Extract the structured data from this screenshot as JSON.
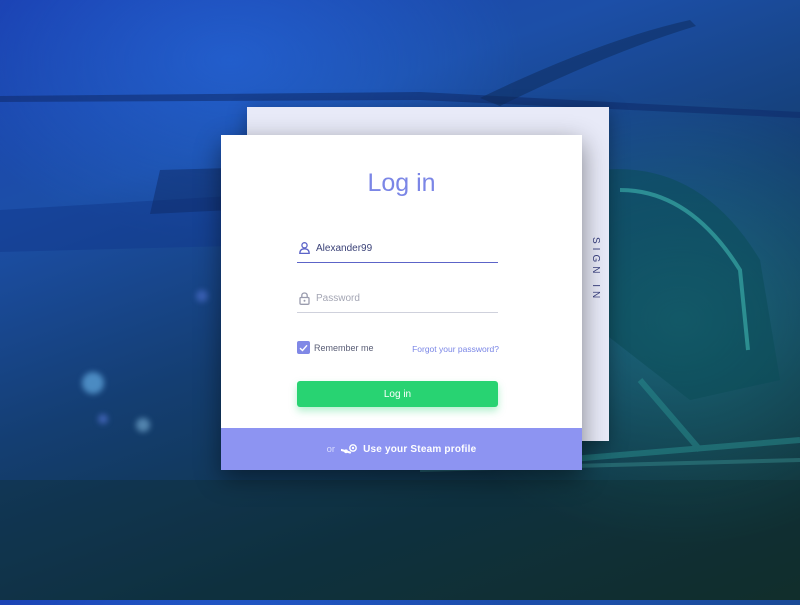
{
  "background": {
    "description_icon": "helicopter-photo"
  },
  "tabs": {
    "sign_in_label": "SIGN IN"
  },
  "form": {
    "title": "Log in",
    "username": {
      "value": "Alexander99",
      "icon": "user-icon"
    },
    "password": {
      "placeholder": "Password",
      "value": "",
      "icon": "lock-icon"
    },
    "remember_me": {
      "label": "Remember me",
      "checked": true
    },
    "forgot_password_label": "Forgot your password?",
    "submit_label": "Log in"
  },
  "steam": {
    "or_label": "or",
    "label": "Use your Steam profile",
    "icon": "steam-icon"
  },
  "colors": {
    "accent": "#7b86e6",
    "button": "#28d372",
    "steam_bar": "#8d94f2",
    "back_card": "#e8eaf8"
  }
}
